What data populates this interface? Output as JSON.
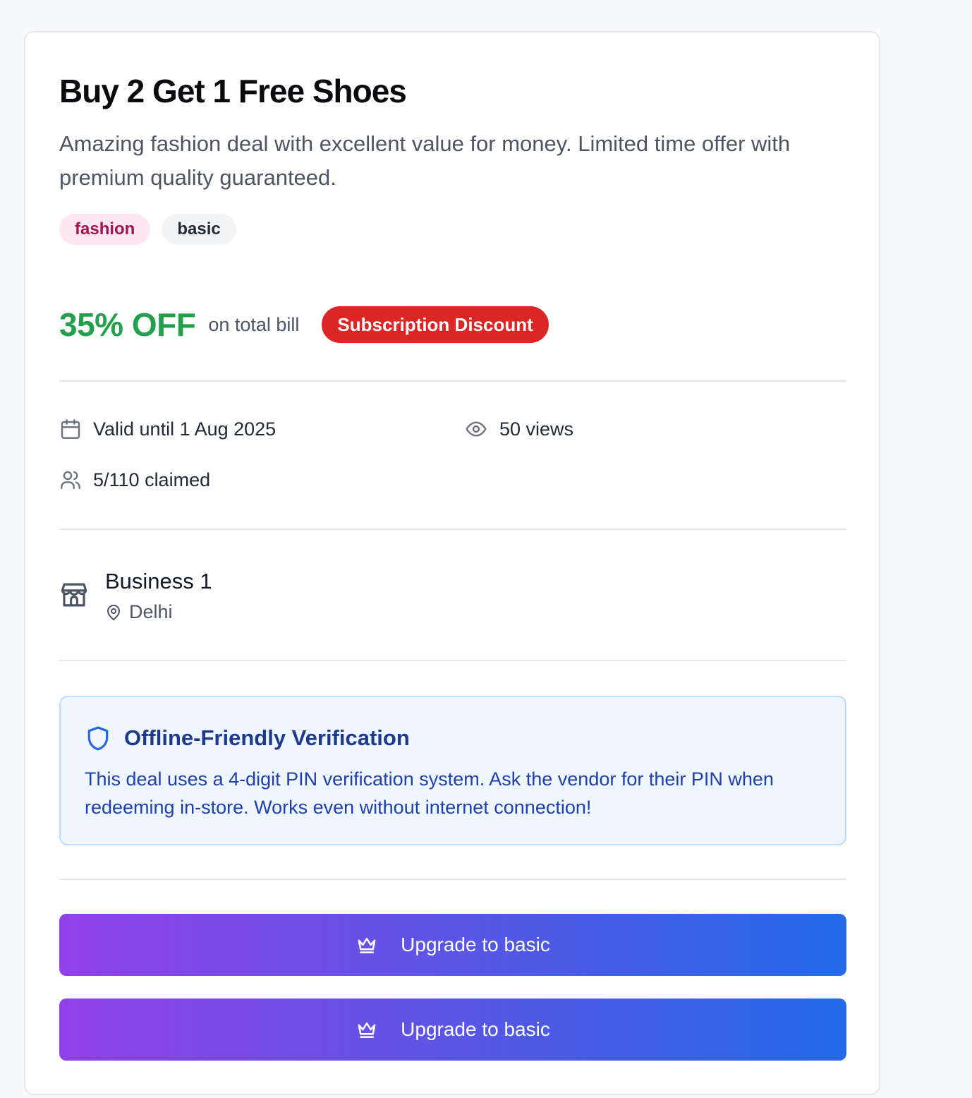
{
  "deal": {
    "title": "Buy 2 Get 1 Free Shoes",
    "description": "Amazing fashion deal with excellent value for money. Limited time offer with premium quality guaranteed.",
    "tags": [
      "fashion",
      "basic"
    ],
    "discount_value": "35% OFF",
    "discount_suffix": "on total bill",
    "discount_badge": "Subscription Discount",
    "valid_until": "Valid until 1 Aug 2025",
    "views": "50 views",
    "claimed": "5/110 claimed"
  },
  "business": {
    "name": "Business 1",
    "location": "Delhi"
  },
  "verification": {
    "title": "Offline-Friendly Verification",
    "text": "This deal uses a 4-digit PIN verification system. Ask the vendor for their PIN when redeeming in-store. Works even without internet connection!"
  },
  "actions": {
    "upgrade_label_1": "Upgrade to basic",
    "upgrade_label_2": "Upgrade to basic"
  },
  "icons": {
    "calendar": "calendar-icon",
    "views": "eye-icon",
    "claimed": "users-icon",
    "business": "store-icon",
    "location": "map-pin-icon",
    "verification": "shield-icon",
    "upgrade": "crown-icon"
  },
  "colors": {
    "discount": "#22a04b",
    "badge": "#dc2626",
    "fashion_tag_bg": "#fce7f3",
    "fashion_tag_text": "#9d174d",
    "verify_bg": "#eff6ff",
    "verify_title": "#1e3a8a",
    "button_gradient_start": "#9041e8",
    "button_gradient_end": "#2369e8"
  }
}
